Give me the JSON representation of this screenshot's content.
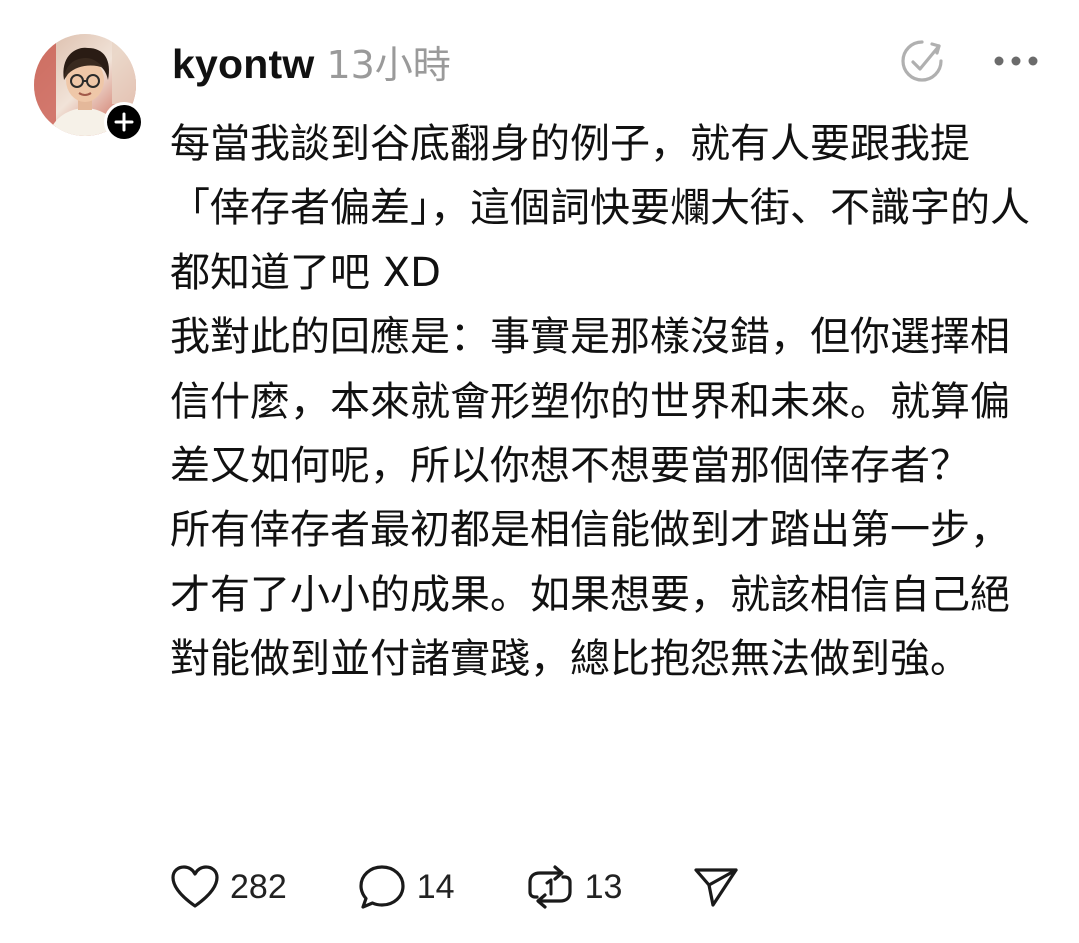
{
  "post": {
    "username": "kyontw",
    "timestamp": "13小時",
    "paragraphs": [
      "每當我談到谷底翻身的例子，就有人要跟我提「倖存者偏差」，這個詞快要爛大街、不識字的人都知道了吧 XD",
      "我對此的回應是：事實是那樣沒錯，但你選擇相信什麼，本來就會形塑你的世界和未來。就算偏差又如何呢，所以你想不想要當那個倖存者？",
      "所有倖存者最初都是相信能做到才踏出第一步，才有了小小的成果。如果想要，就該相信自己絕對能做到並付諸實踐，總比抱怨無法做到強。"
    ],
    "actions": {
      "like_count": "282",
      "comment_count": "14",
      "repost_count": "13"
    }
  },
  "icons": {
    "avatar": "profile-photo",
    "follow": "plus-icon",
    "translate": "translate-icon",
    "more": "more-horizontal-icon",
    "like": "heart-icon",
    "comment": "comment-bubble-icon",
    "repost": "repost-icon",
    "share": "send-icon"
  },
  "colors": {
    "text": "#111111",
    "muted": "#9a9a9a",
    "icon": "#1a1a1a",
    "background": "#ffffff"
  }
}
